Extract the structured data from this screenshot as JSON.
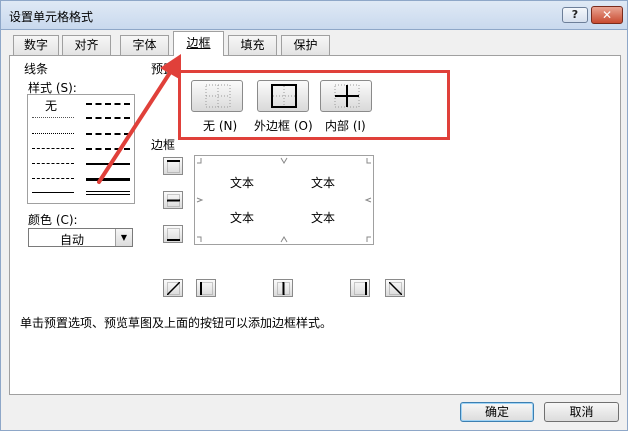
{
  "window": {
    "title": "设置单元格格式",
    "help_label": "?",
    "close_label": "✕"
  },
  "tabs": [
    {
      "label": "数字",
      "active": false
    },
    {
      "label": "对齐",
      "active": false
    },
    {
      "label": "字体",
      "active": false
    },
    {
      "label": "边框",
      "active": true
    },
    {
      "label": "填充",
      "active": false
    },
    {
      "label": "保护",
      "active": false
    }
  ],
  "line_section": {
    "heading": "线条",
    "style_label": "样式 (S):",
    "none_label": "无",
    "color_label": "颜色 (C):",
    "color_value": "自动"
  },
  "presets": {
    "heading": "预置",
    "items": [
      {
        "label": "无 (N)",
        "icon": "no-border-icon"
      },
      {
        "label": "外边框 (O)",
        "icon": "outline-border-icon"
      },
      {
        "label": "内部 (I)",
        "icon": "inside-border-icon"
      }
    ]
  },
  "border_section": {
    "heading": "边框",
    "preview_text": [
      "文本",
      "文本",
      "文本",
      "文本"
    ]
  },
  "hint": "单击预置选项、预览草图及上面的按钮可以添加边框样式。",
  "buttons": {
    "ok": "确定",
    "cancel": "取消"
  },
  "colors": {
    "accent_red": "#e0403a",
    "title_bar": "#c9d9ee"
  }
}
